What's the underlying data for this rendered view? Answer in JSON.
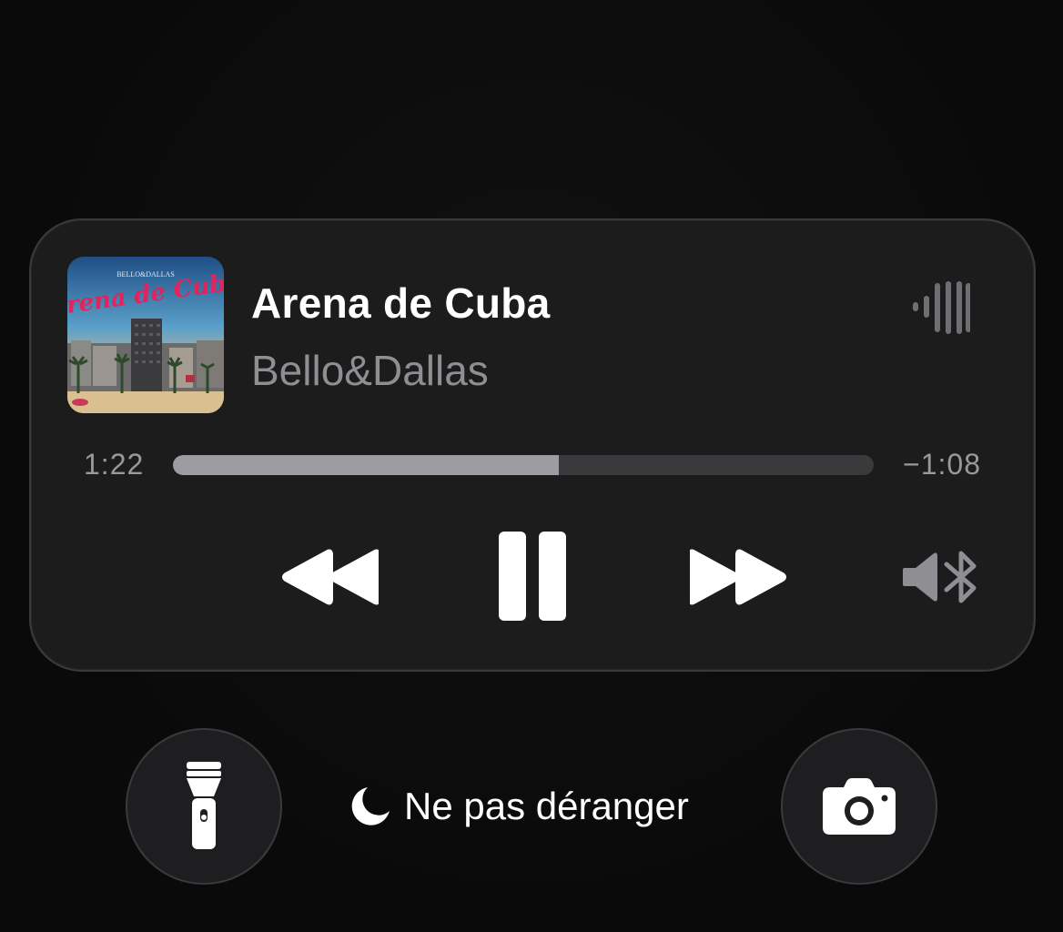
{
  "now_playing": {
    "title": "Arena de Cuba",
    "artist": "Bello&Dallas",
    "artwork": {
      "album_text": "Arena de Cuba",
      "small_text": "BELLO&DALLAS",
      "icon": "album-artwork"
    },
    "elapsed": "1:22",
    "remaining": "−1:08",
    "progress": 0.55
  },
  "controls": {
    "rewind_icon": "rewind-icon",
    "pause_icon": "pause-icon",
    "forward_icon": "fast-forward-icon",
    "audio_output_icon": "speaker-bluetooth-icon",
    "waveform_icon": "audio-waveform-icon"
  },
  "lockscreen": {
    "flashlight_icon": "flashlight-icon",
    "camera_icon": "camera-icon",
    "focus_icon": "moon-icon",
    "focus_label": "Ne pas déranger"
  },
  "colors": {
    "background": "#0b0b0b",
    "card": "#1c1c1d",
    "secondary_text": "#8e8e93",
    "progress_fill": "#9c9ca1",
    "progress_track": "#3a3a3c"
  }
}
